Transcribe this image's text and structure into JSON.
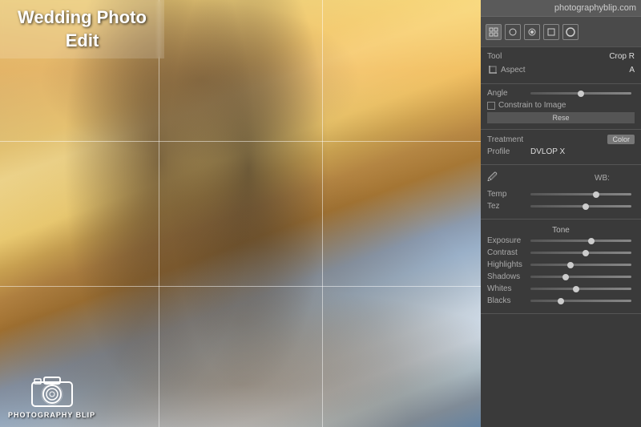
{
  "title": {
    "line1": "Wedding Photo",
    "line2": "Edit",
    "full": "Wedding Photo Edit"
  },
  "website": "photographyblip.com",
  "logo": {
    "text": "PHOTOGRAPHY BLIP"
  },
  "grid": {
    "horizontal_lines": [
      33,
      67
    ],
    "vertical_lines": [
      33,
      67
    ]
  },
  "panel": {
    "tools": [
      "grid-icon",
      "circle-icon",
      "dot-icon",
      "square-icon",
      "circle2-icon"
    ],
    "tool_label": "Tool",
    "tool_value": "Crop R",
    "aspect_label": "Aspect",
    "aspect_value": "A",
    "angle_label": "Angle",
    "angle_value": 50,
    "constrain_label": "Constrain to Image",
    "reset_label": "Rese",
    "treatment_label": "Treatment",
    "treatment_value": "Color",
    "profile_label": "Profile",
    "profile_value": "DVLOP X",
    "wb_label": "WB:",
    "temp_label": "Temp",
    "temp_value": 65,
    "tez_label": "Tez",
    "tez_value": 55,
    "tone_label": "Tone",
    "exposure_label": "Exposure",
    "exposure_value": 60,
    "contrast_label": "Contrast",
    "contrast_value": 55,
    "highlights_label": "Highlights",
    "highlights_value": 40,
    "shadows_label": "Shadows",
    "shadows_value": 35,
    "whites_label": "Whites",
    "whites_value": 45,
    "blacks_label": "Blacks",
    "blacks_value": 30
  }
}
